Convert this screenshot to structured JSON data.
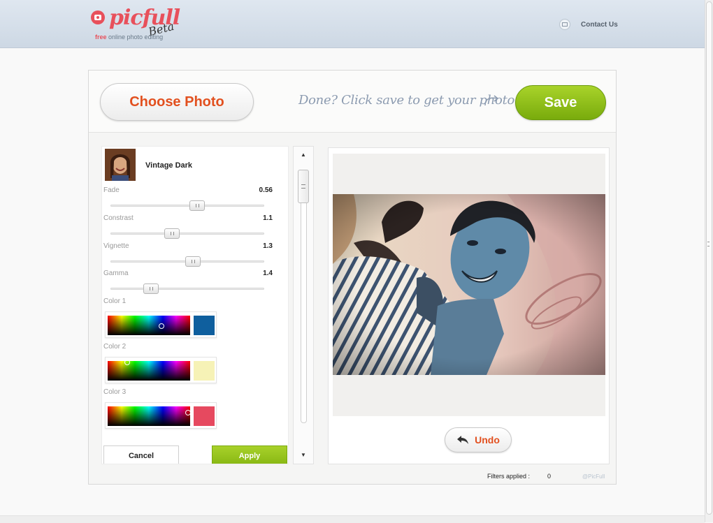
{
  "header": {
    "logo_text": "picfull",
    "logo_beta": "Beta",
    "tagline_free": "free",
    "tagline_rest": " online photo editing",
    "contact_label": "Contact Us"
  },
  "toolbar": {
    "choose_label": "Choose Photo",
    "hint_text": "Done? Click save to get your photo!",
    "save_label": "Save"
  },
  "filter": {
    "name": "Vintage Dark",
    "params": [
      {
        "label": "Fade",
        "value": "0.56",
        "level": 0.56
      },
      {
        "label": "Constrast",
        "value": "1.1",
        "level": 0.4
      },
      {
        "label": "Vignette",
        "value": "1.3",
        "level": 0.53
      },
      {
        "label": "Gamma",
        "value": "1.4",
        "level": 0.26
      }
    ],
    "colors": [
      {
        "label": "Color 1",
        "swatch": "#0f5f9e"
      },
      {
        "label": "Color 2",
        "swatch": "#f6f2b6"
      },
      {
        "label": "Color 3",
        "swatch": "#e6495f"
      }
    ],
    "cancel_label": "Cancel",
    "apply_label": "Apply"
  },
  "list_scroll": {
    "up": "▲",
    "down": "▼"
  },
  "preview": {
    "undo_label": "Undo"
  },
  "status": {
    "filters_label": "Filters applied :",
    "filters_count": "0",
    "credit": "@PicFull"
  }
}
